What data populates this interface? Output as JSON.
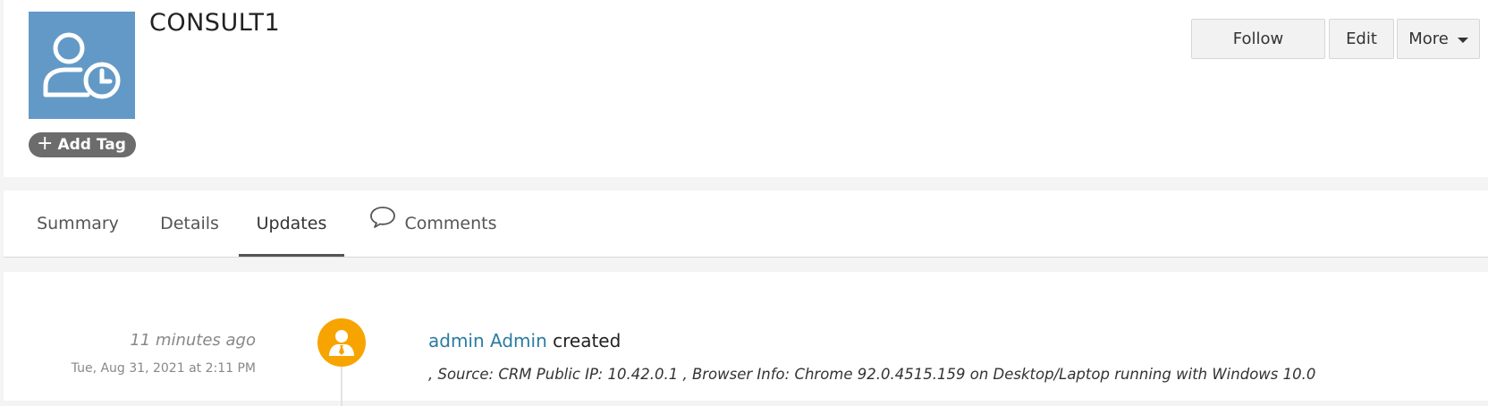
{
  "record": {
    "title": "CONSULT1",
    "avatar_icon": "user-clock-icon",
    "avatar_color": "#6399c6",
    "add_tag_label": "Add Tag"
  },
  "actions": {
    "follow_label": "Follow",
    "edit_label": "Edit",
    "more_label": "More"
  },
  "tabs": [
    {
      "label": "Summary",
      "active": false
    },
    {
      "label": "Details",
      "active": false
    },
    {
      "label": "Updates",
      "active": true
    },
    {
      "label": "Comments",
      "active": false,
      "icon": "comment-bubble-icon"
    }
  ],
  "updates": [
    {
      "time_ago": "11 minutes ago",
      "timestamp": "Tue, Aug 31, 2021 at 2:11 PM",
      "user_icon": "user-tie-icon",
      "user_avatar_color": "#f7a400",
      "user_name": "admin Admin",
      "action": "created",
      "detail": ", Source: CRM Public IP: 10.42.0.1 , Browser Info: Chrome 92.0.4515.159 on Desktop/Laptop running with Windows 10.0"
    }
  ],
  "colors": {
    "link": "#2a7ba2",
    "tag_bg": "#6c6c6c",
    "page_bg": "#f4f4f4"
  }
}
